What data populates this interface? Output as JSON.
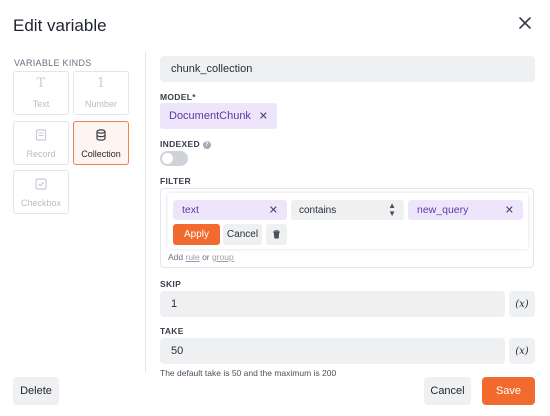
{
  "dialog": {
    "title": "Edit variable"
  },
  "variable_kinds": {
    "label": "VARIABLE KINDS",
    "items": [
      {
        "label": "Text",
        "icon": "text-icon",
        "glyph": "T",
        "selected": false
      },
      {
        "label": "Number",
        "icon": "number-icon",
        "glyph": "1",
        "selected": false
      },
      {
        "label": "Record",
        "icon": "record-icon",
        "glyph": "",
        "selected": false
      },
      {
        "label": "Collection",
        "icon": "database-icon",
        "glyph": "",
        "selected": true
      },
      {
        "label": "Checkbox",
        "icon": "checkbox-icon",
        "glyph": "",
        "selected": false
      }
    ]
  },
  "name": {
    "value": "chunk_collection"
  },
  "model": {
    "label": "MODEL",
    "required_marker": "*",
    "value": "DocumentChunk"
  },
  "indexed": {
    "label": "INDEXED",
    "on": false
  },
  "filter": {
    "label": "FILTER",
    "rule": {
      "field": "text",
      "operator": "contains",
      "value": "new_query"
    },
    "apply_label": "Apply",
    "cancel_label": "Cancel",
    "add_prefix": "Add",
    "add_rule_label": "rule",
    "add_or_label": "or",
    "add_group_label": "group"
  },
  "skip": {
    "label": "SKIP",
    "value": "1",
    "var_button_label": "(x)"
  },
  "take": {
    "label": "TAKE",
    "value": "50",
    "var_button_label": "(x)",
    "help": "The default take is 50 and the maximum is 200"
  },
  "footer": {
    "delete_label": "Delete",
    "cancel_label": "Cancel",
    "save_label": "Save"
  },
  "colors": {
    "accent": "#f26a2e",
    "chip_bg": "#ede6fb",
    "chip_text": "#5b3aa6",
    "input_bg": "#eff0f2"
  }
}
